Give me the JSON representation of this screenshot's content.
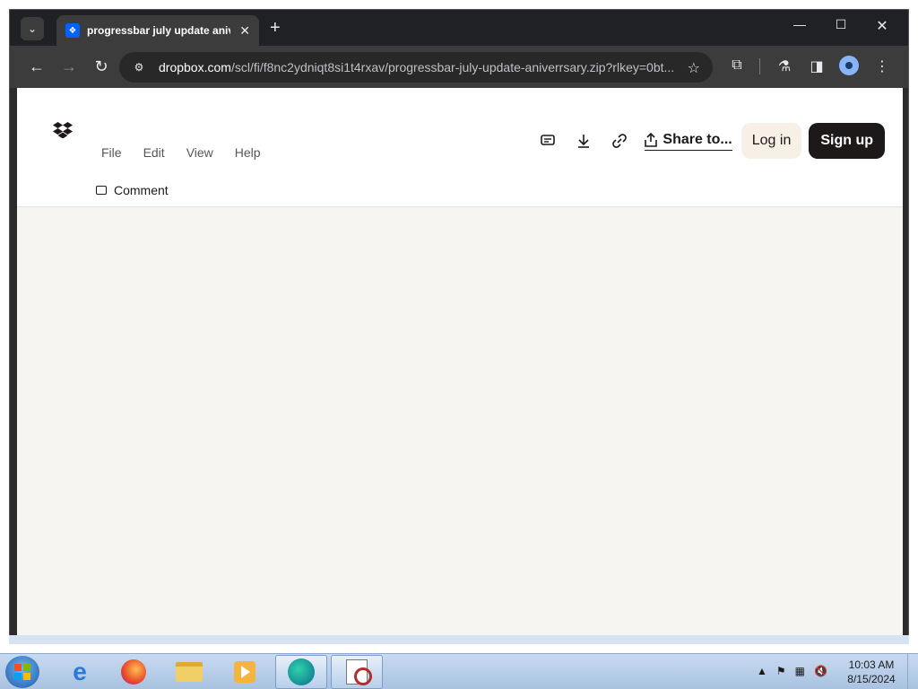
{
  "browser": {
    "tab_title": "progressbar july update aniver",
    "tab_favicon": "dropbox-icon",
    "tab_close": "✕",
    "new_tab": "+",
    "url_host": "dropbox.com",
    "url_path": "/scl/fi/f8nc2ydniqt8si1t4rxav/progressbar-july-update-aniverrsary.zip?rlkey=0bt..."
  },
  "dropbox": {
    "menu": [
      "File",
      "Edit",
      "View",
      "Help"
    ],
    "comment_label": "Comment",
    "share_label": "Share to...",
    "login_label": "Log in",
    "signup_label": "Sign up"
  },
  "taskbar": {
    "apps": [
      "internet-explorer-icon",
      "firefox-icon",
      "file-explorer-icon",
      "media-player-icon",
      "edge-icon",
      "tool-icon"
    ],
    "clock_time": "10:03 AM",
    "clock_date": "8/15/2024"
  },
  "colors": {
    "dropbox_blue": "#0061fe",
    "signup_bg": "#1e1919",
    "login_bg": "#f7f0e6",
    "page_bg": "#f7f5f2"
  }
}
